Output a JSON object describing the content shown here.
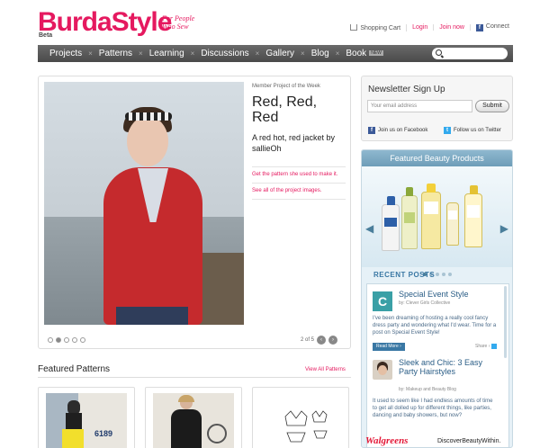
{
  "header": {
    "logo": "BurdaStyle",
    "beta": "Beta",
    "tagline": "For People Who Sew",
    "links": {
      "cart": "Shopping Cart",
      "login": "Login",
      "join": "Join now",
      "connect": "Connect"
    }
  },
  "nav": {
    "items": [
      "Projects",
      "Patterns",
      "Learning",
      "Discussions",
      "Gallery",
      "Blog",
      "Book"
    ],
    "book_badge": "NEW",
    "search_placeholder": ""
  },
  "feature": {
    "kicker": "Member Project of the Week",
    "title": "Red, Red, Red",
    "subtitle": "A red hot, red jacket by sallieOh",
    "link1": "Get the pattern she used to make it.",
    "link2": "See all of the project images.",
    "pager": "2 of 5",
    "prev": "‹",
    "next": "›"
  },
  "newsletter": {
    "title": "Newsletter Sign Up",
    "placeholder": "Your email address",
    "submit": "Submit",
    "facebook": "Join us on Facebook",
    "twitter": "Follow us on Twitter"
  },
  "beauty": {
    "title": "Featured Beauty Products",
    "recent_posts": "RECENT POSTS",
    "posts": [
      {
        "title": "Special Event Style",
        "by": "by: Clever Girls Collective",
        "body": "I've been dreaming of hosting a really cool fancy dress party and wondering what I'd wear. Time for a post on Special Event Style!",
        "read_more": "Read More ›",
        "share": "Share ›"
      },
      {
        "title": "Sleek and Chic: 3 Easy Party Hairstyles",
        "by": "by: Makeup and Beauty Blog",
        "body": "It used to seem like I had endless amounts of time to get all dolled up for different things, like parties, dancing and baby showers, but now?"
      }
    ],
    "sponsor": "Walgreens",
    "sponsor_tagline": "DiscoverBeautyWithin."
  },
  "featured_patterns": {
    "title": "Featured Patterns",
    "view_all": "View All Patterns",
    "card1_number": "6189"
  },
  "colors": {
    "brand_pink": "#e5195f",
    "nav_bg": "#555555",
    "beauty_blue": "#3a78a4"
  }
}
